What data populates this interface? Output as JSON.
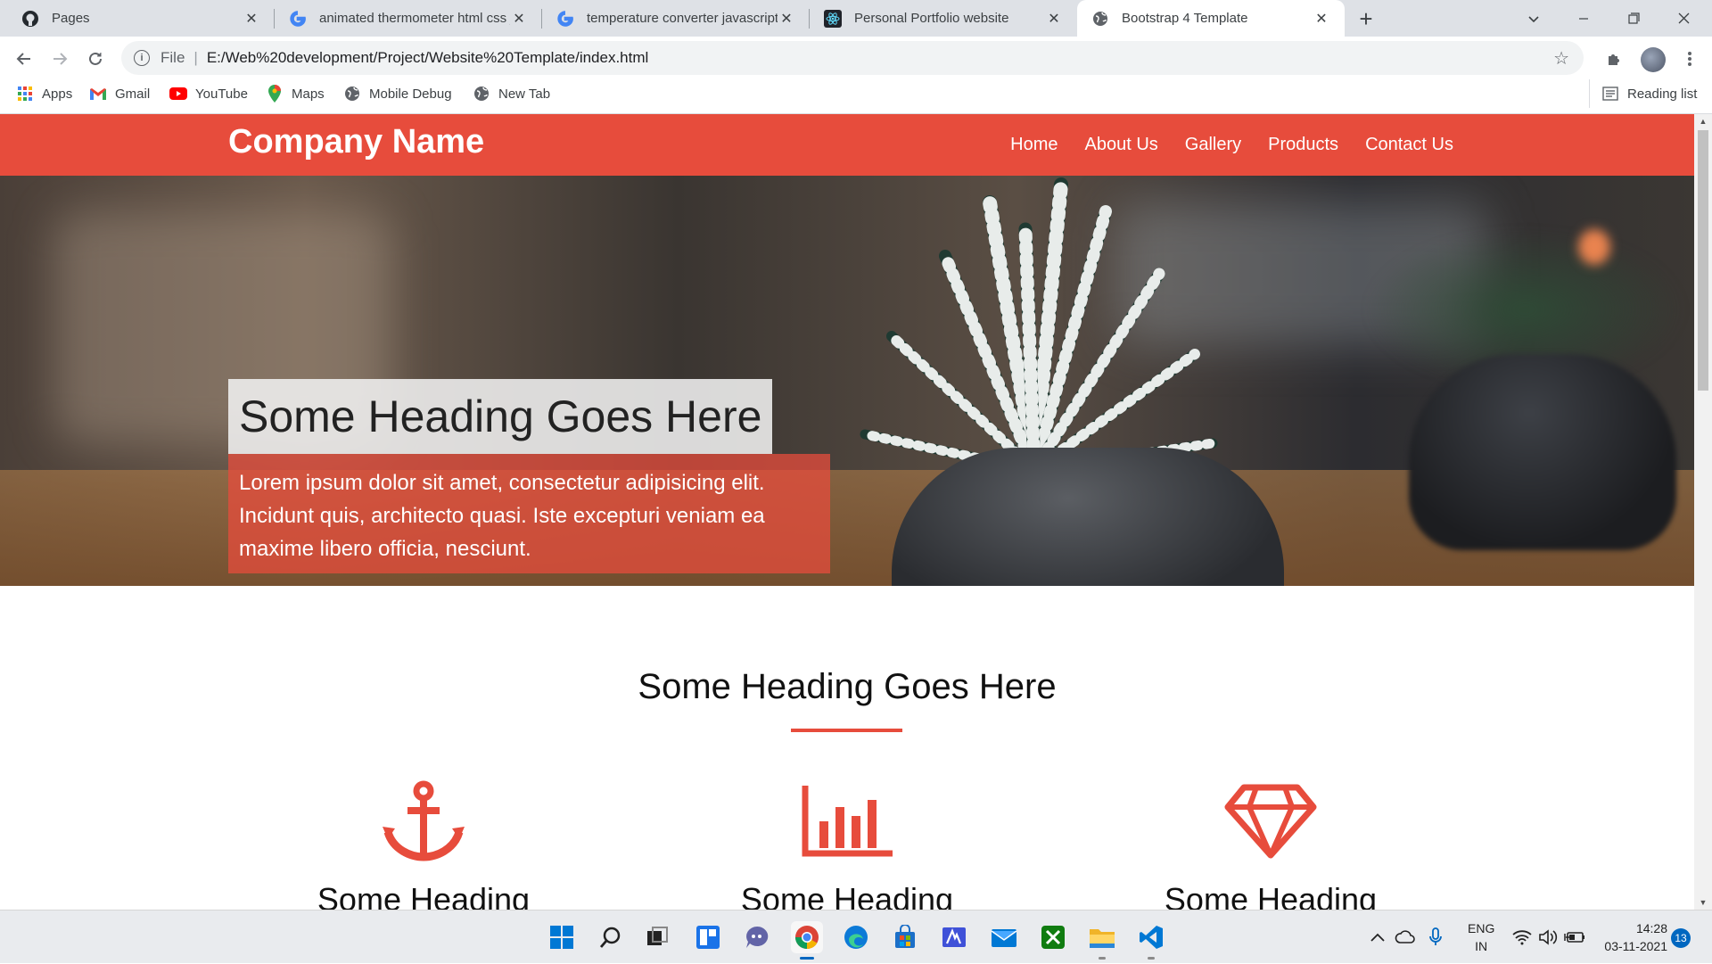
{
  "browser": {
    "tabs": [
      {
        "title": "Pages",
        "icon": "github-icon"
      },
      {
        "title": "animated thermometer html css j",
        "icon": "google-icon"
      },
      {
        "title": "temperature converter javascript",
        "icon": "google-icon"
      },
      {
        "title": "Personal Portfolio website",
        "icon": "react-icon"
      },
      {
        "title": "Bootstrap 4 Template",
        "icon": "globe-icon",
        "active": true
      }
    ],
    "address": {
      "scheme_label": "File",
      "url": "E:/Web%20development/Project/Website%20Template/index.html"
    },
    "bookmarks": [
      {
        "label": "Apps",
        "icon": "apps-grid-icon"
      },
      {
        "label": "Gmail",
        "icon": "gmail-icon"
      },
      {
        "label": "YouTube",
        "icon": "youtube-icon"
      },
      {
        "label": "Maps",
        "icon": "maps-icon"
      },
      {
        "label": "Mobile Debug",
        "icon": "globe-icon"
      },
      {
        "label": "New Tab",
        "icon": "globe-icon"
      }
    ],
    "reading_list": "Reading list"
  },
  "site": {
    "brand": "Company Name",
    "nav": [
      "Home",
      "About Us",
      "Gallery",
      "Products",
      "Contact Us"
    ],
    "hero": {
      "title": "Some Heading Goes Here",
      "text": "Lorem ipsum dolor sit amet, consectetur adipisicing elit. Incidunt quis, architecto quasi. Iste excepturi veniam ea maxime libero officia, nesciunt."
    },
    "section": {
      "heading": "Some Heading Goes Here",
      "features": [
        {
          "icon": "anchor-icon",
          "heading": "Some Heading"
        },
        {
          "icon": "bar-chart-icon",
          "heading": "Some Heading"
        },
        {
          "icon": "diamond-icon",
          "heading": "Some Heading"
        }
      ]
    },
    "accent_color": "#e74c3c"
  },
  "taskbar": {
    "apps": [
      "start-icon",
      "search-icon",
      "task-view-icon",
      "widgets-icon",
      "teams-chat-icon",
      "chrome-icon",
      "edge-icon",
      "store-icon",
      "app-icon",
      "mail-icon",
      "xbox-icon",
      "file-explorer-icon",
      "vscode-icon"
    ],
    "language": {
      "line1": "ENG",
      "line2": "IN"
    },
    "time": "14:28",
    "date": "03-11-2021",
    "notifications": "13"
  }
}
